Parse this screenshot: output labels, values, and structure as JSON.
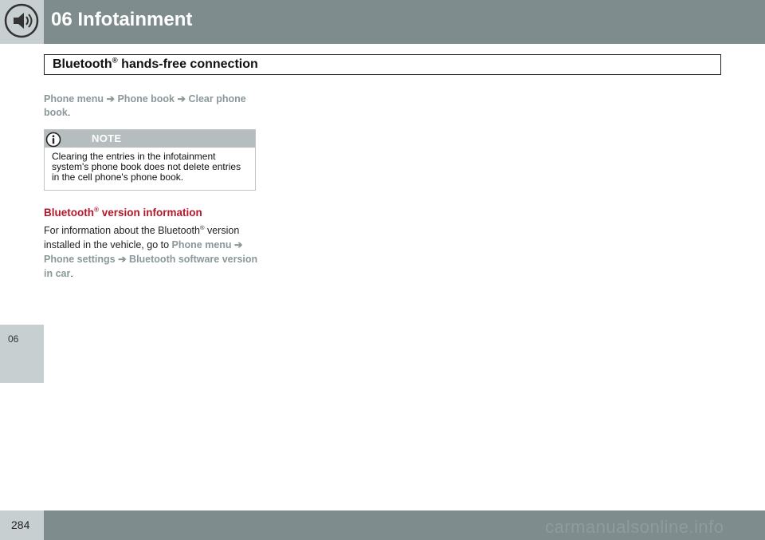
{
  "header": {
    "chapter_title": "06 Infotainment",
    "icon": "speaker-icon",
    "accent_color": "#7e8c8d"
  },
  "side_tab": {
    "label": "06"
  },
  "section": {
    "title": "Bluetooth",
    "title_sup": "®",
    "title_rest": " hands-free connection"
  },
  "para1": {
    "menu1": "Phone menu",
    "arrow": "➔",
    "menu2": "Phone book",
    "menu3": "Clear phone book",
    "end": "."
  },
  "note": {
    "label": "NOTE",
    "icon": "info-icon",
    "text": "Clearing the entries in the infotainment system's phone book does not delete entries in the cell phone's phone book."
  },
  "version_section": {
    "heading_pre": "Bluetooth",
    "heading_sup": "®",
    "heading_post": " version information",
    "text_pre": "For information about the Bluetooth",
    "text_sup": "®",
    "text_mid": " version installed in the vehicle, go to ",
    "menu1": "Phone menu",
    "menu2": "Phone settings",
    "menu3": "Bluetooth software version in car",
    "end": ".",
    "heading_color": "#b3182b"
  },
  "footer": {
    "page_number": "284",
    "watermark": "carmanualsonline.info"
  }
}
